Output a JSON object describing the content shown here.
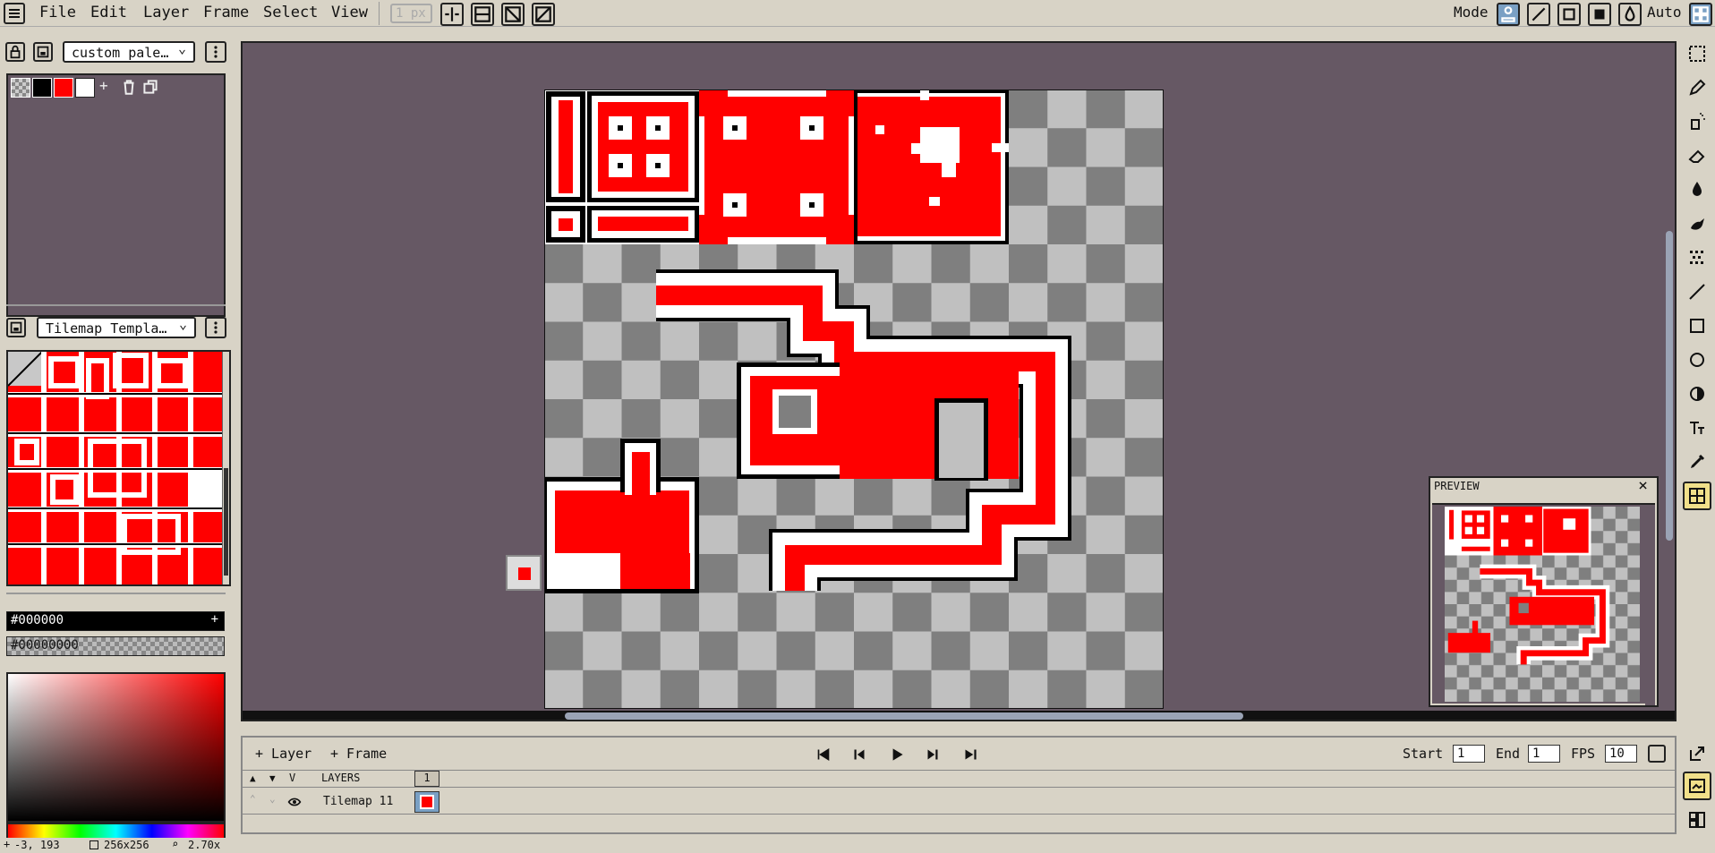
{
  "menubar": {
    "items": [
      "File",
      "Edit",
      "Layer",
      "Frame",
      "Select",
      "View"
    ],
    "brush_size": "1 px",
    "mode_label": "Mode",
    "auto_label": "Auto"
  },
  "palette": {
    "name": "custom pale…",
    "swatches": [
      "transparent",
      "#000000",
      "#ff0000",
      "#ffffff"
    ],
    "add": "+"
  },
  "tileset": {
    "name": "Tilemap Templa…"
  },
  "colors": {
    "primary": "#000000",
    "secondary": "#00000000",
    "add": "+"
  },
  "preview": {
    "title": "PREVIEW",
    "close": "×"
  },
  "timeline": {
    "add_layer": "+ Layer",
    "add_frame": "+ Frame",
    "start_label": "Start",
    "start": "1",
    "end_label": "End",
    "end": "1",
    "fps_label": "FPS",
    "fps": "10",
    "layers_header": "LAYERS",
    "frame_number": "1",
    "layer_name": "Tilemap 11",
    "col_v": "V"
  },
  "status": {
    "cursor": "-3, 193",
    "size": "256x256",
    "zoom": "2.70x"
  },
  "theme": {
    "canvas_bg": "#665864",
    "accent_red": "#ff0000",
    "panel_bg": "#d8d3c6"
  }
}
